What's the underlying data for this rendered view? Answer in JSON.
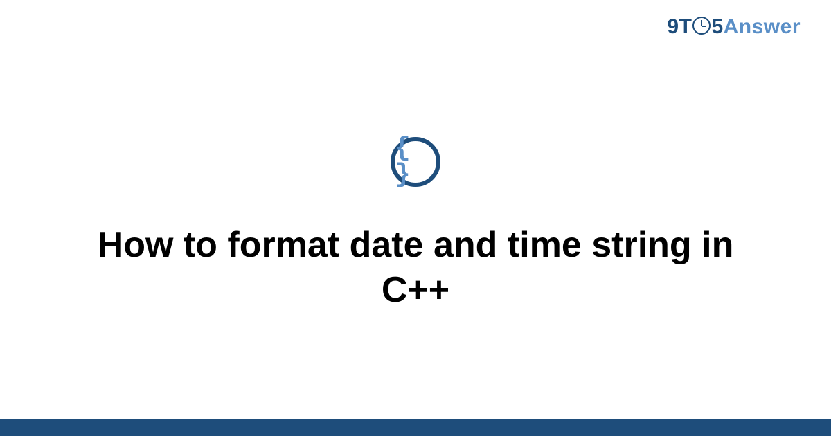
{
  "logo": {
    "part1": "9T",
    "part2": "5",
    "part3": "Answer"
  },
  "icon": {
    "braces": "{ }",
    "name": "code-braces-icon"
  },
  "title": "How to format date and time string in C++",
  "colors": {
    "primary": "#1e4d7b",
    "secondary": "#5a8fc7"
  }
}
